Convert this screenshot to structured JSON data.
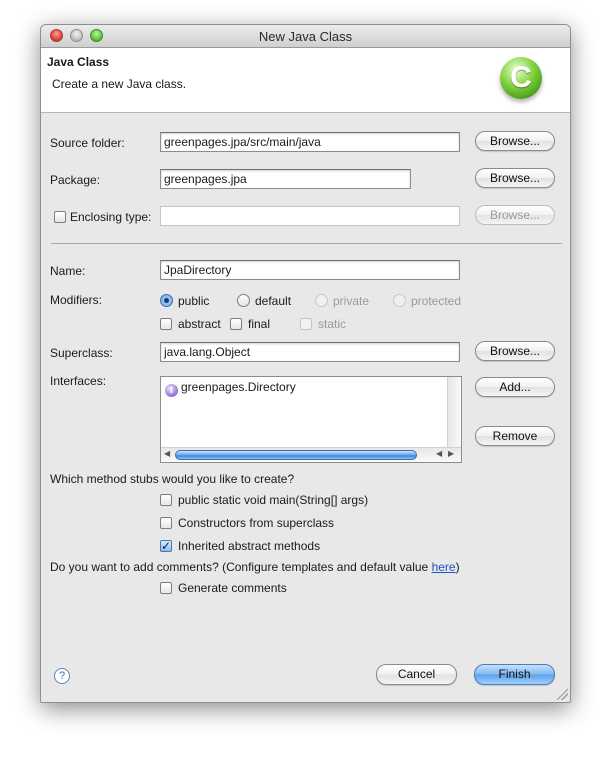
{
  "window": {
    "title": "New Java Class"
  },
  "header": {
    "title": "Java Class",
    "description": "Create a new Java class.",
    "icon": "java-class-icon",
    "icon_glyph": "C"
  },
  "form": {
    "source_folder": {
      "label": "Source folder:",
      "value": "greenpages.jpa/src/main/java",
      "browse": "Browse..."
    },
    "package": {
      "label": "Package:",
      "value": "greenpages.jpa",
      "browse": "Browse..."
    },
    "enclosing_type": {
      "label": "Enclosing type:",
      "value": "",
      "checked": false,
      "browse": "Browse..."
    },
    "name": {
      "label": "Name:",
      "value": "JpaDirectory"
    },
    "modifiers": {
      "label": "Modifiers:",
      "visibility": [
        {
          "label": "public",
          "selected": true,
          "enabled": true
        },
        {
          "label": "default",
          "selected": false,
          "enabled": true
        },
        {
          "label": "private",
          "selected": false,
          "enabled": false
        },
        {
          "label": "protected",
          "selected": false,
          "enabled": false
        }
      ],
      "flags": [
        {
          "label": "abstract",
          "checked": false,
          "enabled": true
        },
        {
          "label": "final",
          "checked": false,
          "enabled": true
        },
        {
          "label": "static",
          "checked": false,
          "enabled": false
        }
      ]
    },
    "superclass": {
      "label": "Superclass:",
      "value": "java.lang.Object",
      "browse": "Browse..."
    },
    "interfaces": {
      "label": "Interfaces:",
      "items": [
        "greenpages.Directory"
      ],
      "add": "Add...",
      "remove": "Remove"
    },
    "stubs": {
      "question": "Which method stubs would you like to create?",
      "options": [
        {
          "label": "public static void main(String[] args)",
          "checked": false
        },
        {
          "label": "Constructors from superclass",
          "checked": false
        },
        {
          "label": "Inherited abstract methods",
          "checked": true
        }
      ]
    },
    "comments": {
      "question_prefix": "Do you want to add comments? (Configure templates and default value ",
      "link": "here",
      "question_suffix": ")",
      "option": {
        "label": "Generate comments",
        "checked": false
      }
    }
  },
  "footer": {
    "help_glyph": "?",
    "cancel": "Cancel",
    "finish": "Finish"
  },
  "glyphs": {
    "check": "✓",
    "left_arrow": "◀",
    "right_arrow": "▶"
  },
  "colors": {
    "default_button": "#5d9fe8",
    "link": "#2050c0",
    "dialog_bg": "#e8e8e8"
  }
}
